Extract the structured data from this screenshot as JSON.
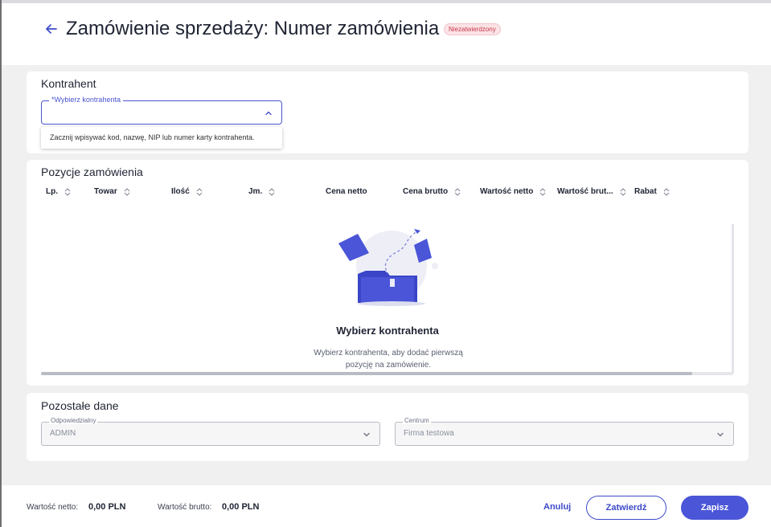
{
  "header": {
    "title": "Zamówienie sprzedaży: Numer zamówienia",
    "status_badge": "Niezatwierdzony"
  },
  "kontrahent_section": {
    "title": "Kontrahent",
    "field_label": "*Wybierz kontrahenta",
    "field_value": "",
    "hint": "Zacznij wpisywać kod, nazwę, NIP lub numer karty kontrahenta."
  },
  "pozycje_section": {
    "title": "Pozycje zamówienia",
    "columns": [
      "Lp.",
      "Towar",
      "Ilość",
      "Jm.",
      "Cena netto",
      "Cena brutto",
      "Wartość netto",
      "Wartość brut...",
      "Rabat"
    ],
    "empty_title": "Wybierz kontrahenta",
    "empty_description": "Wybierz kontrahenta, aby dodać pierwszą pozycję na zamówienie."
  },
  "pozostale_section": {
    "title": "Pozostałe dane",
    "odpowiedzialny_label": "Odpowiedzialny",
    "odpowiedzialny_value": "ADMIN",
    "centrum_label": "Centrum",
    "centrum_value": "Firma testowa"
  },
  "footer": {
    "netto_label": "Wartość netto:",
    "netto_value": "0,00 PLN",
    "brutto_label": "Wartość brutto:",
    "brutto_value": "0,00 PLN",
    "cancel_label": "Anuluj",
    "confirm_label": "Zatwierdź",
    "save_label": "Zapisz"
  },
  "icons": {
    "back": "arrow-left-icon",
    "chevron_up": "chevron-up-icon",
    "chevron_down": "chevron-down-icon",
    "sort": "sort-icon",
    "illustration": "empty-folder-illustration"
  },
  "colors": {
    "accent": "#4a55d8",
    "badge_bg": "#fbe3e6",
    "badge_text": "#c8384b",
    "page_bg": "#f0f0f1"
  }
}
